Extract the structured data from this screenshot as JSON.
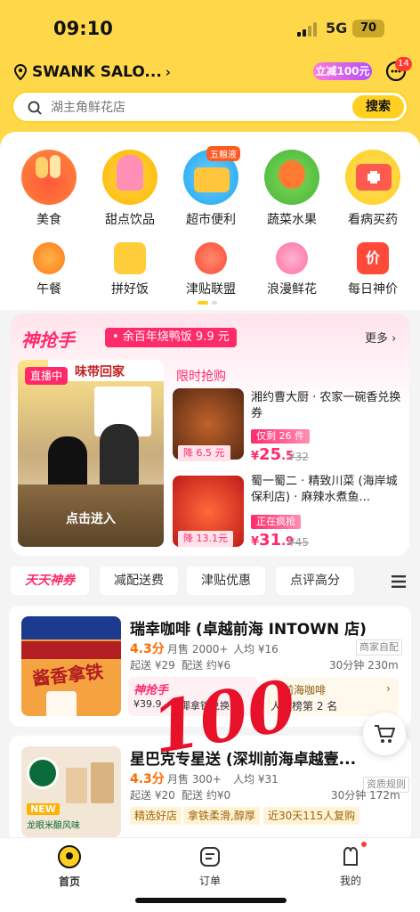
{
  "status": {
    "time": "09:10",
    "network": "5G",
    "battery": "70"
  },
  "header": {
    "location": "SWANK SALO...",
    "location_chevron": "›",
    "promo": "立减100元",
    "message_badge": "14"
  },
  "search": {
    "placeholder": "湖主角鲜花店",
    "button": "搜索"
  },
  "categories_row1": [
    {
      "label": "美食",
      "icon": "food-icon"
    },
    {
      "label": "甜点饮品",
      "icon": "dessert-icon"
    },
    {
      "label": "超市便利",
      "icon": "supermarket-icon",
      "badge": "五粮液"
    },
    {
      "label": "蔬菜水果",
      "icon": "fruit-icon"
    },
    {
      "label": "看病买药",
      "icon": "medicine-icon"
    }
  ],
  "categories_row2": [
    {
      "label": "午餐",
      "icon": "lunch-icon"
    },
    {
      "label": "拼好饭",
      "icon": "group-meal-icon"
    },
    {
      "label": "津贴联盟",
      "icon": "allowance-icon"
    },
    {
      "label": "浪漫鲜花",
      "icon": "flower-icon"
    },
    {
      "label": "每日神价",
      "icon": "price-icon",
      "icon_text": "价"
    }
  ],
  "flash": {
    "logo": "神抢手",
    "tag": "• 余百年烧鸭饭 9.9 元",
    "more": "更多 ›",
    "live_badge": "直播中",
    "live_banner": "味带回家",
    "live_enter": "点击进入",
    "limited": "限时抢购",
    "items": [
      {
        "name": "湘约曹大厨 · 农家一碗香兑换券",
        "tag": "仅剩 26 件",
        "discount": "降 6.5 元",
        "price_symbol": "¥",
        "price_int": "25",
        "price_dec": ".5",
        "original": "¥32"
      },
      {
        "name": "蜀一蜀二 · 精致川菜 (海岸城保利店) · 麻辣水煮鱼...",
        "tag": "正在疯抢",
        "discount": "降 13.1元",
        "price_symbol": "¥",
        "price_int": "31",
        "price_dec": ".9",
        "original": "¥45"
      }
    ]
  },
  "filters": [
    "天天神券",
    "减配送费",
    "津贴优惠",
    "点评高分"
  ],
  "stores": [
    {
      "title": "瑞幸咖啡 (卓越前海 INTOWN 店)",
      "rating": "4.3分",
      "sales": "月售 2000+",
      "avg": "人均 ¥16",
      "tag": "商家自配",
      "min": "起送 ¥29",
      "delivery": "配送 约¥6",
      "time_dist": "30分钟  230m",
      "logo_text": "酱香拿铁",
      "promo_logo": "神抢手",
      "promo_price": "¥39.9",
      "promo_text": "生椰拿铁兑换券",
      "rank_label": "前海咖啡",
      "rank_text": "人气榜第 2 名"
    },
    {
      "title": "星巴克专星送 (深圳前海卓越壹...",
      "rating": "4.3分",
      "sales": "月售 300+",
      "avg": "人均 ¥31",
      "tag": "资质规则",
      "min": "起送 ¥20",
      "delivery": "配送 约¥0",
      "time_dist": "30分钟  172m",
      "new_label": "NEW",
      "logo_text": "龙眼米酿风味",
      "chips": [
        "精选好店",
        "拿铁柔滑,醇厚",
        "近30天115人复购"
      ]
    }
  ],
  "overlay": "100",
  "tabs": [
    {
      "label": "首页",
      "icon": "home-icon"
    },
    {
      "label": "订单",
      "icon": "order-icon"
    },
    {
      "label": "我的",
      "icon": "profile-icon"
    }
  ],
  "colors": {
    "brand_yellow": "#ffd84a",
    "accent_pink": "#ff2a6a"
  }
}
